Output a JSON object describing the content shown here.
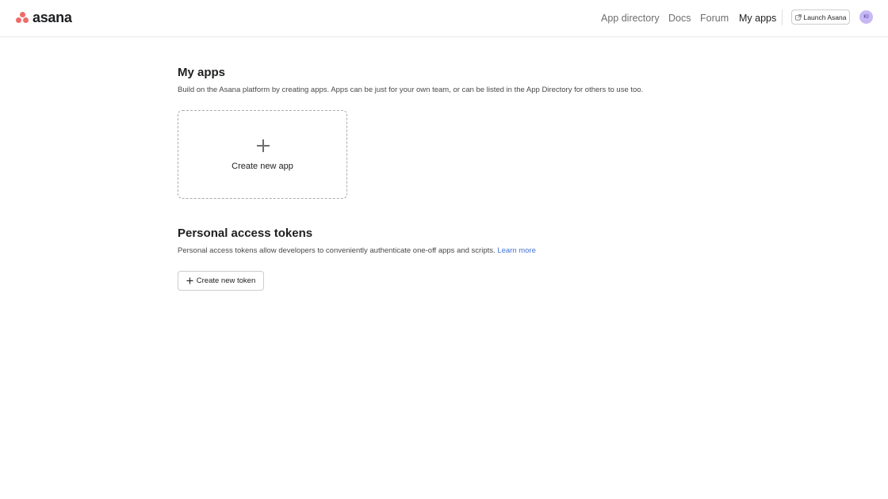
{
  "header": {
    "logo_text": "asana",
    "nav": {
      "app_directory": "App directory",
      "docs": "Docs",
      "forum": "Forum",
      "my_apps": "My apps"
    },
    "launch_label": "Launch Asana",
    "avatar_initials": "KI"
  },
  "my_apps": {
    "title": "My apps",
    "description": "Build on the Asana platform by creating apps. Apps can be just for your own team, or can be listed in the App Directory for others to use too.",
    "create_label": "Create new app"
  },
  "tokens": {
    "title": "Personal access tokens",
    "description": "Personal access tokens allow developers to conveniently authenticate one-off apps and scripts.",
    "learn_more": "Learn more",
    "create_label": "Create new token"
  },
  "colors": {
    "brand": "#f06a6a",
    "link": "#4573d2",
    "avatar_bg": "#c7b8f5"
  },
  "icons": {
    "logo": "asana-logo-icon",
    "launch": "external-link-icon",
    "create_app": "plus-icon",
    "create_token": "plus-icon"
  }
}
